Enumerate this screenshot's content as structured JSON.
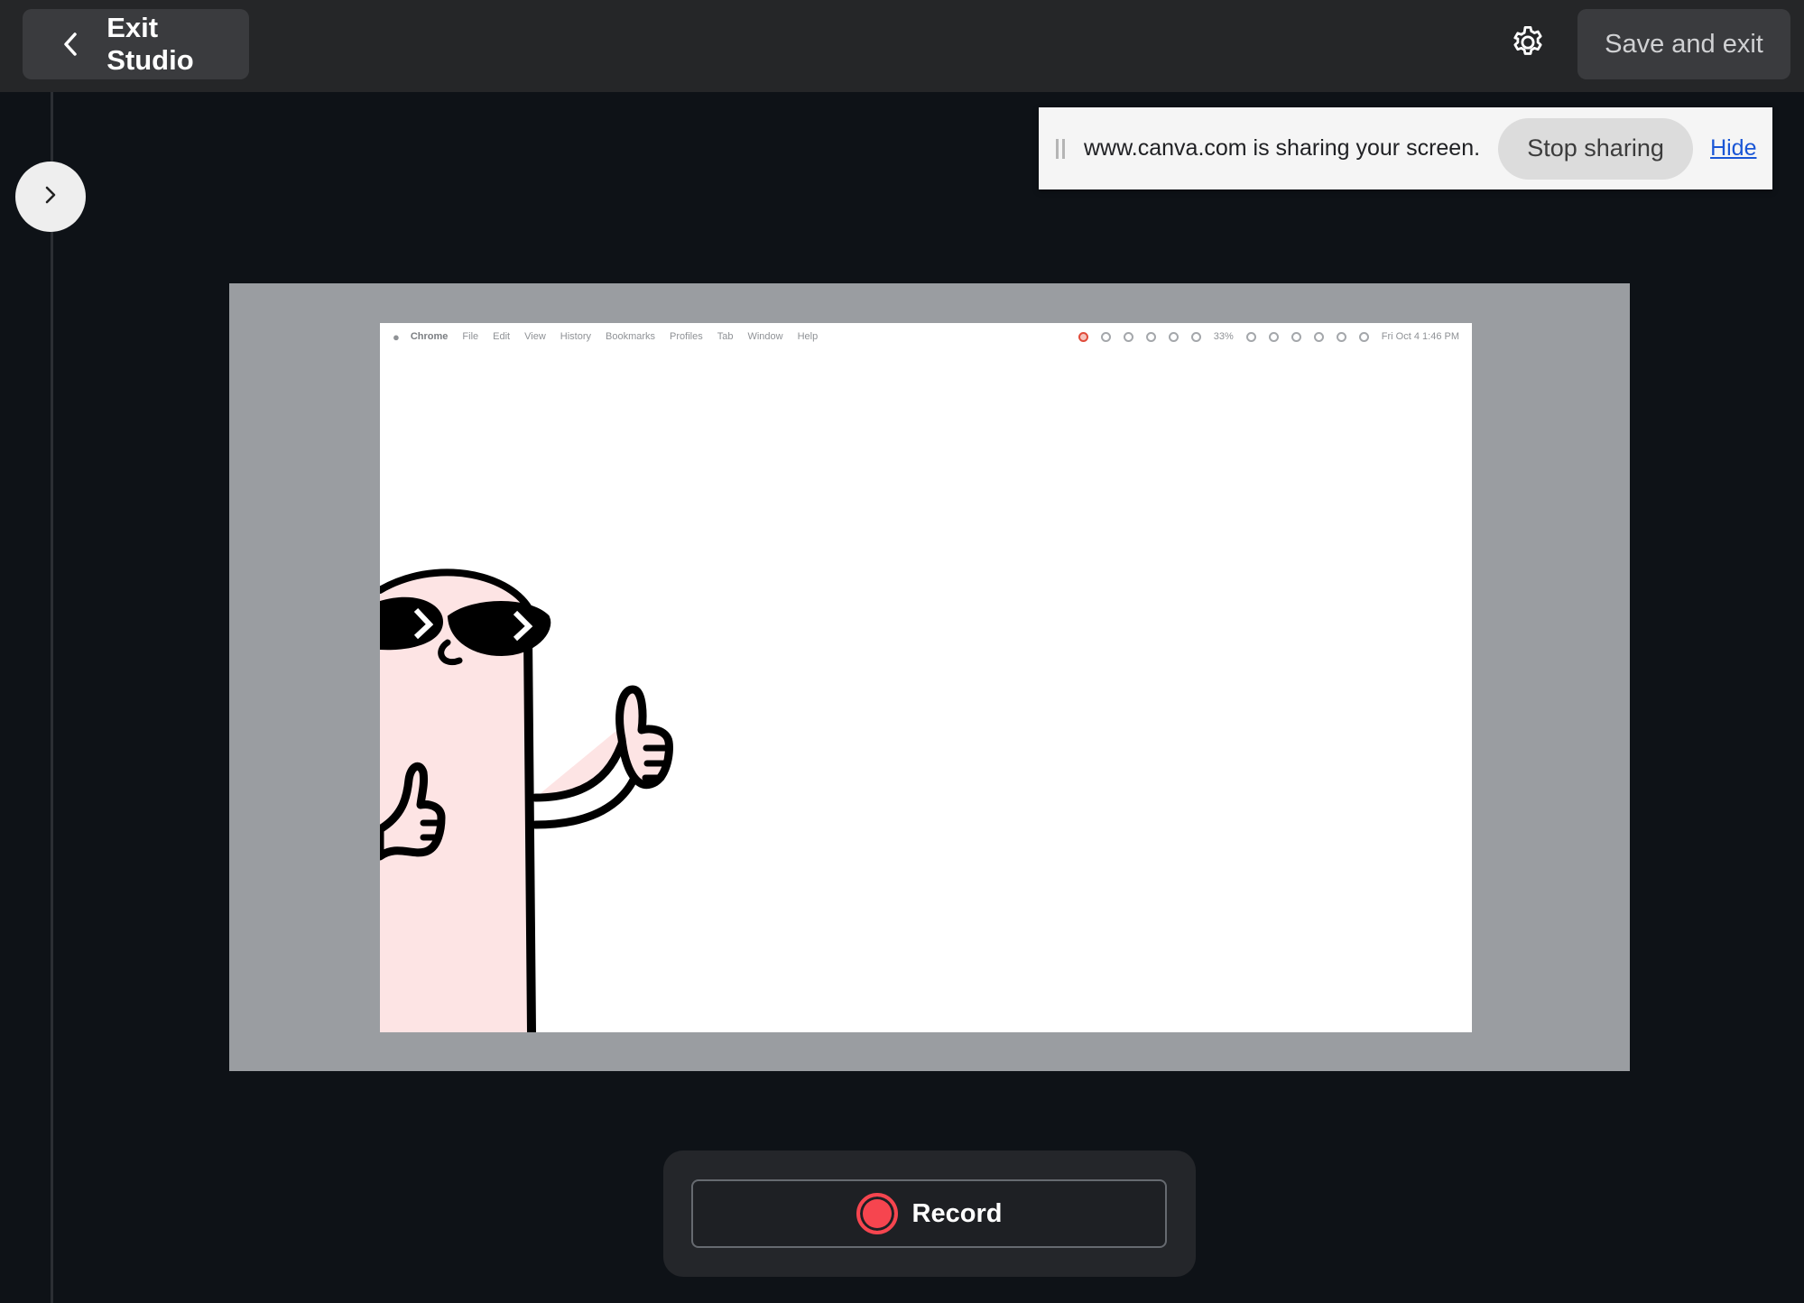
{
  "header": {
    "exit_label": "Exit Studio",
    "save_label": "Save and exit"
  },
  "sharing_bar": {
    "message": "www.canva.com is sharing your screen.",
    "stop_label": "Stop sharing",
    "hide_label": "Hide"
  },
  "screen_preview": {
    "menubar": {
      "app_name": "Chrome",
      "items": [
        "File",
        "Edit",
        "View",
        "History",
        "Bookmarks",
        "Profiles",
        "Tab",
        "Window",
        "Help"
      ],
      "battery": "33%",
      "clock": "Fri Oct 4  1:46 PM"
    }
  },
  "record": {
    "label": "Record"
  },
  "colors": {
    "background": "#0e1217",
    "topbar": "#252628",
    "record_red": "#f6454f",
    "link_blue": "#1a56d6",
    "character_pink": "#fde4e4"
  },
  "icons": {
    "exit": "chevron-left-icon",
    "settings": "gear-icon",
    "expand": "chevron-right-icon",
    "record": "record-dot-icon"
  }
}
